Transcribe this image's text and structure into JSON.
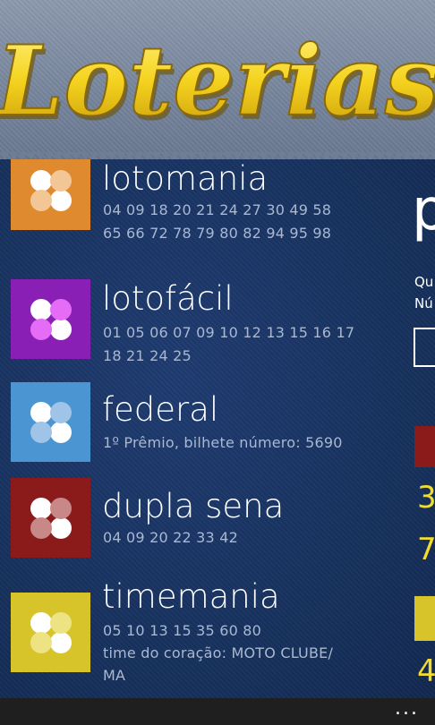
{
  "header": {
    "title": "Loterias"
  },
  "colors": {
    "lotomania": "#e08a30",
    "lotofacil": "#8a1fb6",
    "federal": "#4a95d2",
    "dupla_sena": "#8b1a1a",
    "timemania": "#d6c42a",
    "title_yellow": "#f4d21e"
  },
  "lotteries": [
    {
      "name": "lotomania",
      "line1": "04 09 18 20 21 24 27 30 49 58",
      "line2": "65 66 72 78 79 80 82 94 95 98",
      "icon": "clover-icon"
    },
    {
      "name": "lotofácil",
      "line1": "01 05 06 07 09 10 12 13 15 16 17",
      "line2": "18 21 24 25",
      "icon": "clover-icon"
    },
    {
      "name": "federal",
      "line1": "1º Prêmio, bilhete número: 5690",
      "icon": "clover-icon"
    },
    {
      "name": "dupla sena",
      "line1": " 04 09 20 22 33 42",
      "icon": "clover-icon"
    },
    {
      "name": "timemania",
      "line1": " 05 10 13 15 35 60 80",
      "line2": "time do coração: MOTO CLUBE/",
      "line3": "MA",
      "icon": "clover-icon"
    }
  ],
  "right_panel": {
    "heading": "p",
    "line_q": "Qu",
    "line_n": "Nú",
    "num1": "3",
    "num2": "7",
    "num3": "4"
  },
  "appbar": {
    "more": "..."
  }
}
